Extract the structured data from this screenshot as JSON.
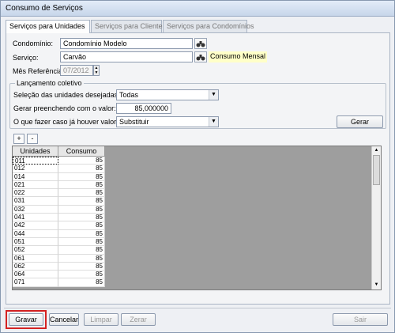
{
  "window": {
    "title": "Consumo de Serviços"
  },
  "tabs": [
    {
      "label": "Serviços para Unidades"
    },
    {
      "label": "Serviços para Clientes"
    },
    {
      "label": "Serviços para Condomínios"
    }
  ],
  "form": {
    "condominio_label": "Condomínio:",
    "condominio_value": "Condomínio Modelo",
    "servico_label": "Serviço:",
    "servico_value": "Carvão",
    "servico_hint": "Consumo Mensal",
    "mes_label": "Mês Referência:",
    "mes_value": "07/2012"
  },
  "batch": {
    "group_title": "Lançamento coletivo",
    "selecao_label": "Seleção das unidades desejadas:",
    "selecao_value": "Todas",
    "gerar_valor_label": "Gerar preenchendo com o valor:",
    "gerar_valor_value": "85,000000",
    "existing_label": "O que fazer caso já houver valores?",
    "existing_value": "Substituir",
    "gerar_button": "Gerar"
  },
  "grid_controls": {
    "add": "+",
    "remove": "-"
  },
  "grid": {
    "columns": [
      "Unidades",
      "Consumo"
    ],
    "rows": [
      [
        "011",
        "85"
      ],
      [
        "012",
        "85"
      ],
      [
        "014",
        "85"
      ],
      [
        "021",
        "85"
      ],
      [
        "022",
        "85"
      ],
      [
        "031",
        "85"
      ],
      [
        "032",
        "85"
      ],
      [
        "041",
        "85"
      ],
      [
        "042",
        "85"
      ],
      [
        "044",
        "85"
      ],
      [
        "051",
        "85"
      ],
      [
        "052",
        "85"
      ],
      [
        "061",
        "85"
      ],
      [
        "062",
        "85"
      ],
      [
        "064",
        "85"
      ],
      [
        "071",
        "85"
      ]
    ]
  },
  "footer": {
    "gravar": "Gravar",
    "cancelar": "Cancelar",
    "limpar": "Limpar",
    "zerar": "Zerar",
    "sair": "Sair"
  },
  "colors": {
    "highlight": "#d42222",
    "hint_bg": "#ffffc8",
    "grid_bg": "#9e9e9e"
  }
}
